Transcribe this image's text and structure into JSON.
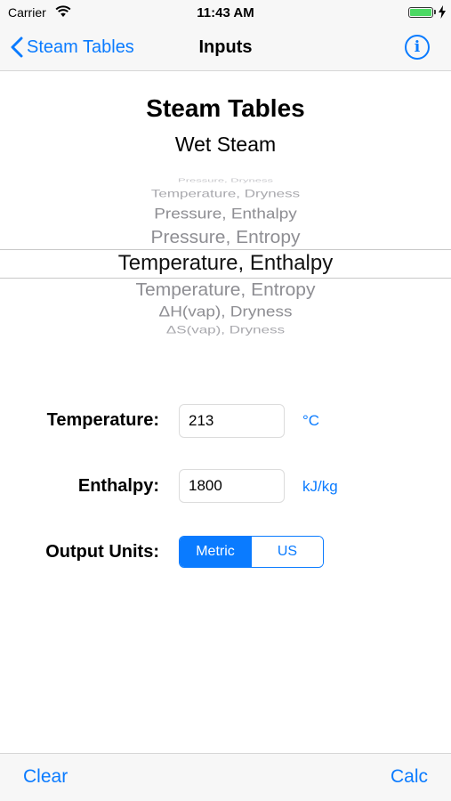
{
  "status_bar": {
    "carrier": "Carrier",
    "time": "11:43 AM",
    "battery_level": 1.0
  },
  "nav": {
    "back_label": "Steam Tables",
    "title": "Inputs",
    "info_label": "i"
  },
  "header": {
    "title": "Steam Tables",
    "subtitle": "Wet Steam"
  },
  "picker": {
    "items": [
      "Pressure, Dryness",
      "Temperature, Dryness",
      "Pressure, Enthalpy",
      "Pressure, Entropy",
      "Temperature, Enthalpy",
      "Temperature, Entropy",
      "ΔH(vap), Dryness",
      "ΔS(vap), Dryness"
    ],
    "selected": "Temperature, Enthalpy"
  },
  "form": {
    "temperature": {
      "label": "Temperature:",
      "value": "213",
      "unit": "°C"
    },
    "enthalpy": {
      "label": "Enthalpy:",
      "value": "1800",
      "unit": "kJ/kg"
    },
    "output_units": {
      "label": "Output Units:",
      "options": [
        "Metric",
        "US"
      ],
      "selected": "Metric"
    }
  },
  "toolbar": {
    "clear_label": "Clear",
    "calc_label": "Calc"
  },
  "colors": {
    "accent": "#0a7bff",
    "bar_background": "#f7f7f7",
    "picker_text": "#8e8e93",
    "battery": "#4cd964"
  }
}
